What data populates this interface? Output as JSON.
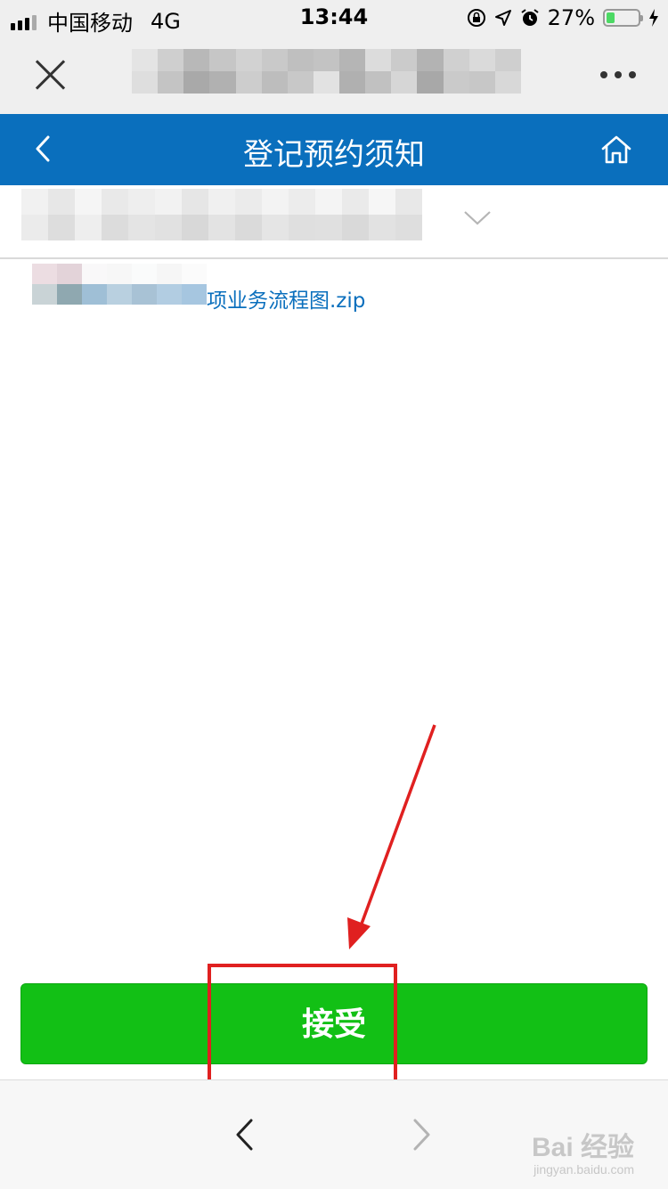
{
  "status_bar": {
    "carrier": "中国移动",
    "network": "4G",
    "time": "13:44",
    "battery": "27%",
    "battery_level": 0.27
  },
  "page_header": {
    "title": "登记预约须知"
  },
  "file": {
    "name_suffix": "项业务流程图.zip"
  },
  "accept_button": {
    "label": "接受"
  },
  "watermark": {
    "brand": "Bai 经验",
    "url": "jingyan.baidu.com"
  },
  "colors": {
    "header_blue": "#0a6fbd",
    "accept_green": "#12c015",
    "annotation_red": "#e02020",
    "battery_green": "#4cd964"
  },
  "icons": {
    "header_left": "back-chevron-icon",
    "header_right": "home-icon",
    "dropdown": "chevron-down-icon",
    "wechat_left": "close-icon",
    "wechat_right": "more-dots-icon"
  }
}
